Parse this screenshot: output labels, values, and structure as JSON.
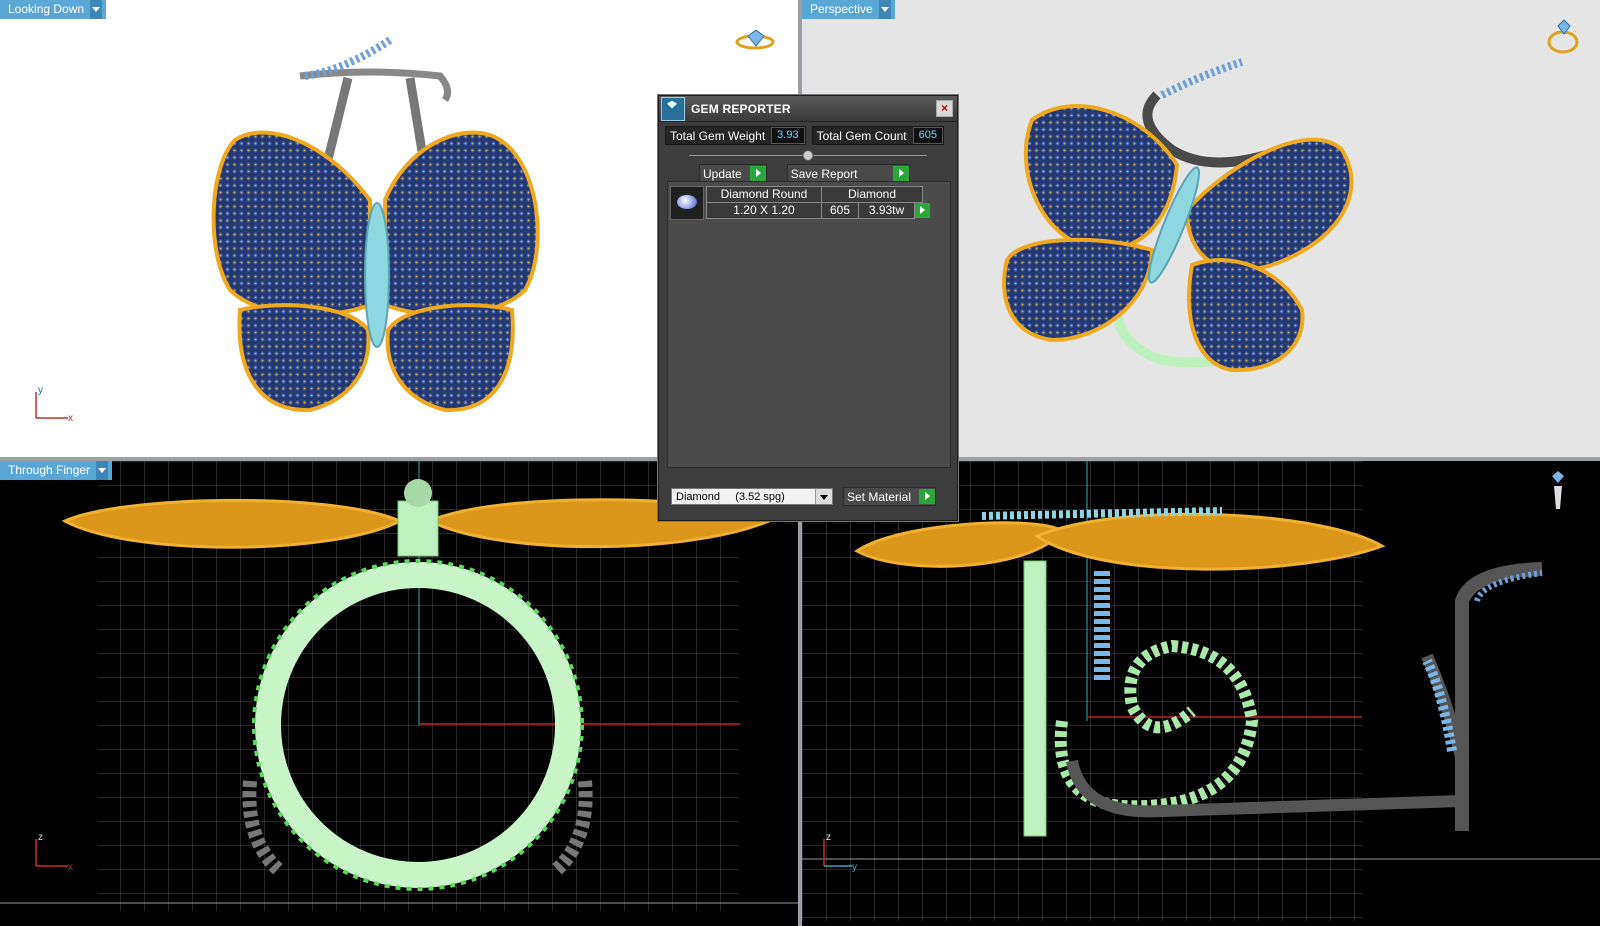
{
  "viewports": {
    "top_left": {
      "label": "Looking Down",
      "axes": [
        "y",
        "x"
      ]
    },
    "top_right": {
      "label": "Perspective"
    },
    "bottom_left": {
      "label": "Through Finger",
      "axes": [
        "z",
        "x"
      ]
    },
    "bottom_right": {
      "axes": [
        "z",
        "y"
      ]
    }
  },
  "gem_reporter": {
    "title": "GEM REPORTER",
    "total_gem_weight_label": "Total Gem Weight",
    "total_gem_weight": "3.93",
    "total_gem_count_label": "Total Gem Count",
    "total_gem_count": "605",
    "update_label": "Update",
    "save_report_label": "Save Report",
    "gem_row": {
      "shape": "Diamond Round",
      "size": "1.20 X 1.20",
      "material": "Diamond",
      "count": "605",
      "weight": "3.93tw"
    },
    "material_select": "Diamond     (3.52 spg)",
    "set_material_label": "Set Material"
  },
  "colors": {
    "viewport_label_bg": "#5aa7d6",
    "gold": "#f0a81e",
    "wing_fill": "#2a3f7a",
    "gem_blue": "#7ab6e8",
    "shank_green": "#bff0bf",
    "metal_grey": "#7a7a7a",
    "play_button": "#2aa63a"
  },
  "icons": [
    "ring-view-icon",
    "perspective-ring-icon",
    "side-view-ring-icon",
    "gem-icon",
    "close-icon"
  ]
}
